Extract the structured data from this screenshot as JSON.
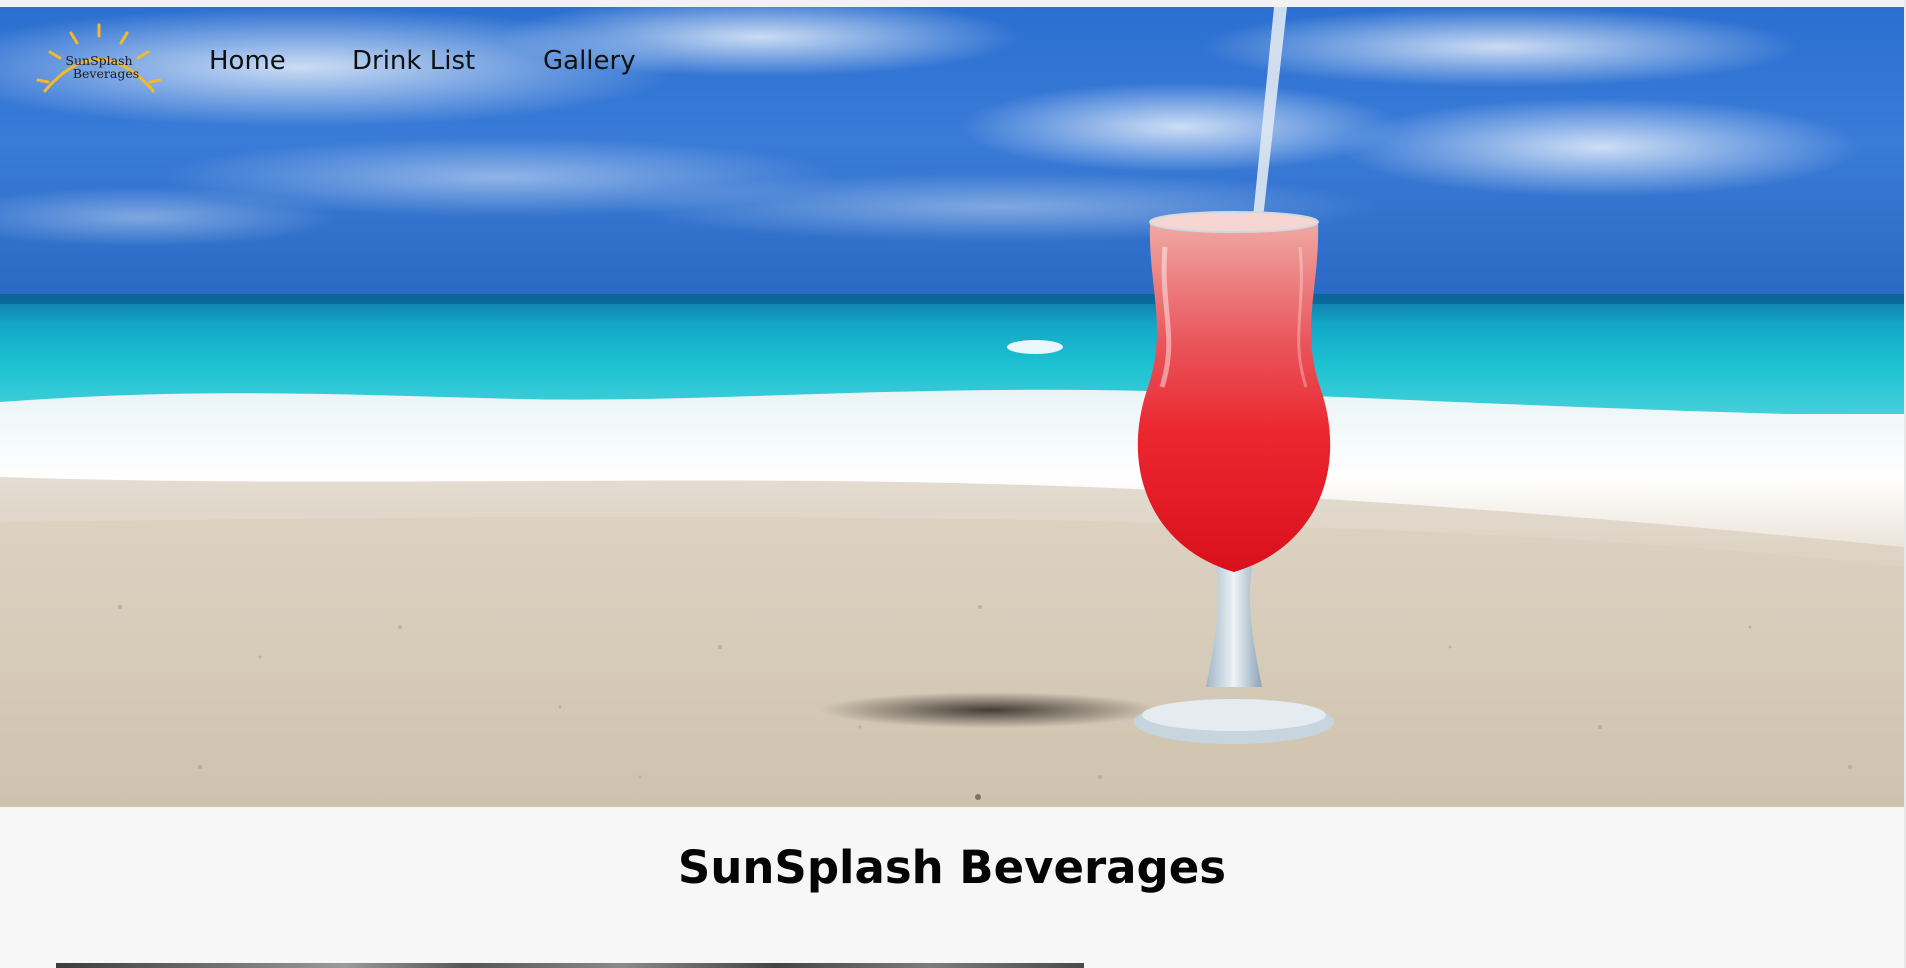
{
  "brand": {
    "logo_line1": "SunSplash",
    "logo_line2": "Beverages",
    "logo_color": "#f3b82c"
  },
  "nav": {
    "items": [
      {
        "label": "Home"
      },
      {
        "label": "Drink List"
      },
      {
        "label": "Gallery"
      }
    ]
  },
  "hero": {
    "icon": "beach-cocktail-photo"
  },
  "main": {
    "title": "SunSplash Beverages"
  }
}
